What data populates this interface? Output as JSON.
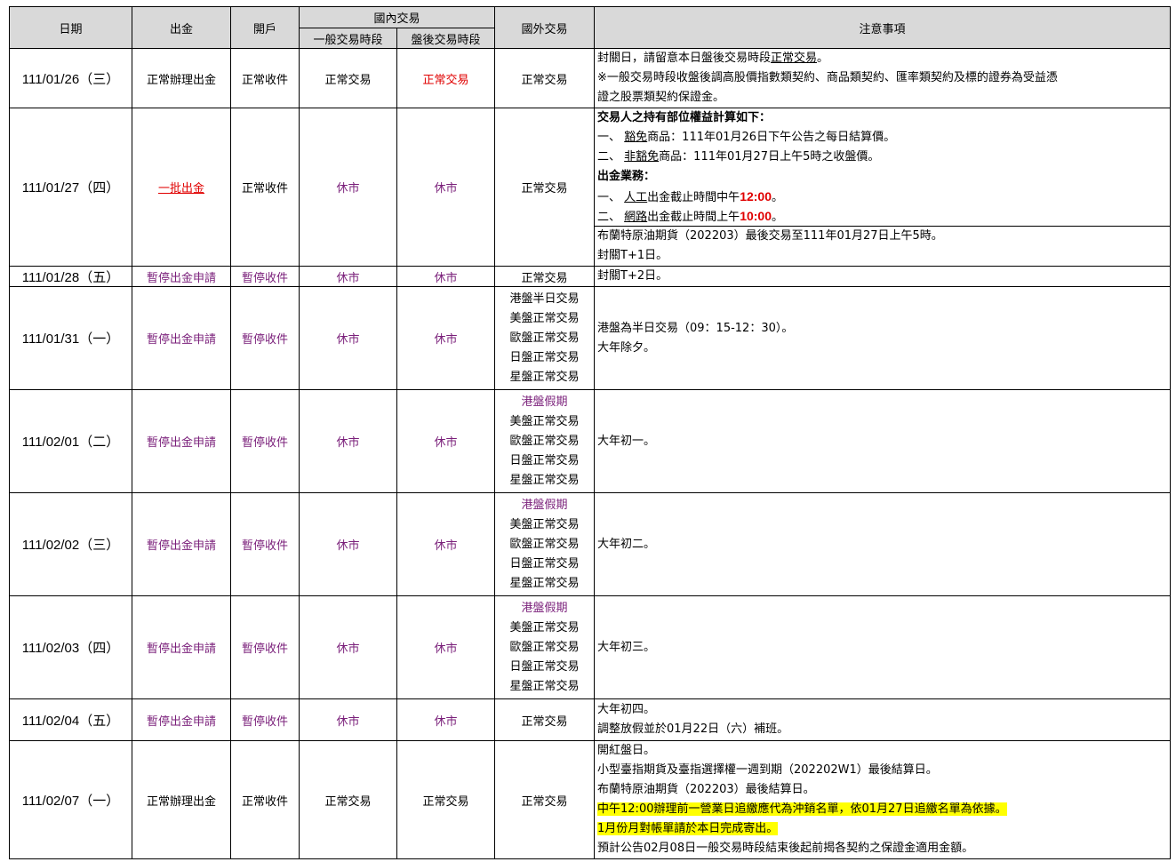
{
  "headers": {
    "date": "日期",
    "withdraw": "出金",
    "account": "開戶",
    "domestic": "國內交易",
    "regular_session": "一般交易時段",
    "after_hours": "盤後交易時段",
    "foreign": "國外交易",
    "notes": "注意事項"
  },
  "rows": [
    {
      "date": "111/01/26（三）",
      "withdraw": "正常辦理出金",
      "account": "正常收件",
      "regular": "正常交易",
      "after": "正常交易",
      "foreign": [
        "正常交易"
      ],
      "notes": [
        "封關日，請留意本日盤後交易時段正常交易。",
        "※一般交易時段收盤後調高股價指數類契約、商品類契約、匯率類契約及標的證券為受益憑",
        "證之股票類契約保證金。"
      ]
    },
    {
      "date": "111/01/27（四）",
      "withdraw": "一批出金",
      "account": "正常收件",
      "regular": "休市",
      "after": "休市",
      "foreign": [
        "正常交易"
      ],
      "notes": [
        "交易人之持有部位權益計算如下：",
        "一、 豁免商品：111年01月26日下午公告之每日結算價。",
        "二、 非豁免商品：111年01月27日上午5時之收盤價。",
        "出金業務：",
        "一、 人工出金截止時間中午12:00。",
        "二、 網路出金截止時間上午10:00。"
      ],
      "notes_extra": [
        "布蘭特原油期貨（202203）最後交易至111年01月27日上午5時。",
        "封關T+1日。"
      ]
    },
    {
      "date": "111/01/28（五）",
      "withdraw": "暫停出金申請",
      "account": "暫停收件",
      "regular": "休市",
      "after": "休市",
      "foreign": [
        "正常交易"
      ],
      "notes": [
        "封關T+2日。"
      ]
    },
    {
      "date": "111/01/31（一）",
      "withdraw": "暫停出金申請",
      "account": "暫停收件",
      "regular": "休市",
      "after": "休市",
      "foreign": [
        "港盤半日交易",
        "美盤正常交易",
        "歐盤正常交易",
        "日盤正常交易",
        "星盤正常交易"
      ],
      "notes": [
        "港盤為半日交易（09：15-12：30）。",
        "大年除夕。"
      ]
    },
    {
      "date": "111/02/01（二）",
      "withdraw": "暫停出金申請",
      "account": "暫停收件",
      "regular": "休市",
      "after": "休市",
      "foreign": [
        "港盤假期",
        "美盤正常交易",
        "歐盤正常交易",
        "日盤正常交易",
        "星盤正常交易"
      ],
      "notes": [
        "大年初一。"
      ]
    },
    {
      "date": "111/02/02（三）",
      "withdraw": "暫停出金申請",
      "account": "暫停收件",
      "regular": "休市",
      "after": "休市",
      "foreign": [
        "港盤假期",
        "美盤正常交易",
        "歐盤正常交易",
        "日盤正常交易",
        "星盤正常交易"
      ],
      "notes": [
        "大年初二。"
      ]
    },
    {
      "date": "111/02/03（四）",
      "withdraw": "暫停出金申請",
      "account": "暫停收件",
      "regular": "休市",
      "after": "休市",
      "foreign": [
        "港盤假期",
        "美盤正常交易",
        "歐盤正常交易",
        "日盤正常交易",
        "星盤正常交易"
      ],
      "notes": [
        "大年初三。"
      ]
    },
    {
      "date": "111/02/04（五）",
      "withdraw": "暫停出金申請",
      "account": "暫停收件",
      "regular": "休市",
      "after": "休市",
      "foreign": [
        "正常交易"
      ],
      "notes": [
        "大年初四。",
        "調整放假並於01月22日（六）補班。"
      ]
    },
    {
      "date": "111/02/07（一）",
      "withdraw": "正常辦理出金",
      "account": "正常收件",
      "regular": "正常交易",
      "after": "正常交易",
      "foreign": [
        "正常交易"
      ],
      "notes": [
        "開紅盤日。",
        "小型臺指期貨及臺指選擇權一週到期（202202W1）最後結算日。",
        "布蘭特原油期貨（202203）最後結算日。",
        "中午12:00辦理前一營業日追繳應代為沖銷名單，依01月27日追繳名單為依據。",
        "1月份月對帳單請於本日完成寄出。",
        "預計公告02月08日一般交易時段結束後起前揭各契約之保證金適用金額。"
      ]
    }
  ]
}
